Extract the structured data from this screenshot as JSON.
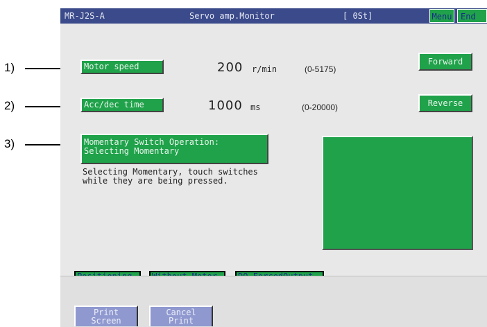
{
  "callouts": [
    "1)",
    "2)",
    "3)"
  ],
  "titlebar": {
    "model": "MR-J2S-A",
    "title": "Servo amp.Monitor",
    "status": "[ 0St]",
    "menu_label": "Menu",
    "end_label": "End"
  },
  "rows": [
    {
      "label": "Motor speed",
      "value": "200",
      "unit": "r/min",
      "range": "(0-5175)",
      "button": "Forward"
    },
    {
      "label": "Acc/dec time",
      "value": "1000",
      "unit": "ms",
      "range": "(0-20000)",
      "button": "Reverse"
    }
  ],
  "mode": {
    "line1": "Momentary Switch Operation:",
    "line2": "Selecting Momentary",
    "desc1": "Selecting Momentary, touch switches",
    "desc2": "while they are being pressed."
  },
  "bottom_tabs": [
    "Positioning",
    "Without Motor",
    "DO ForcedOutput"
  ],
  "print_buttons": [
    {
      "line1": "Print",
      "line2": "Screen"
    },
    {
      "line1": "Cancel",
      "line2": "Print"
    }
  ],
  "colors": {
    "accent_green": "#1fa24a",
    "titlebar": "#3a4a8a",
    "print_button": "#8f99cf"
  }
}
